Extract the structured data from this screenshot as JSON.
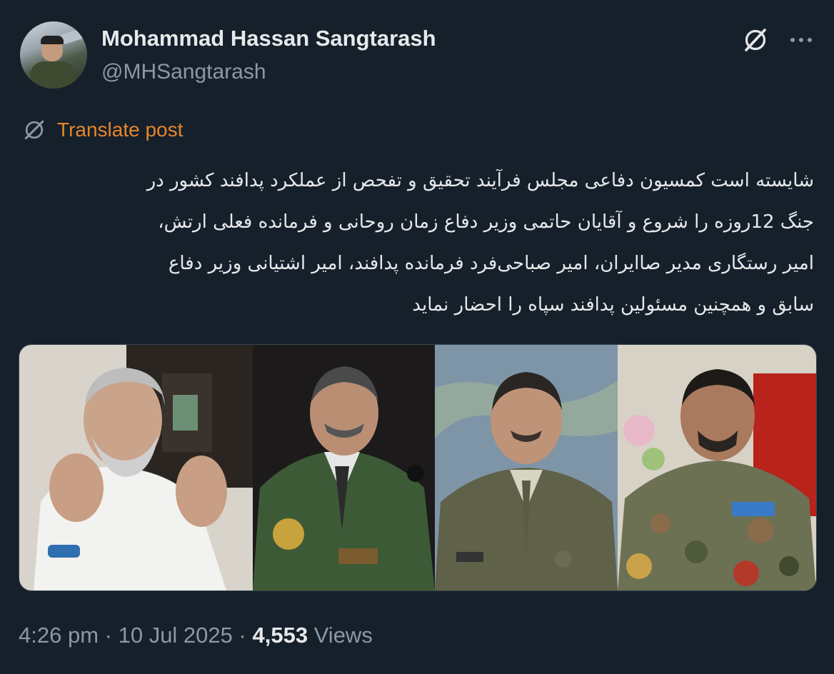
{
  "author": {
    "name": "Mohammad Hassan Sangtarash",
    "handle": "@MHSangtarash"
  },
  "actions": {
    "grok_icon": "grok-icon",
    "more_label": "···"
  },
  "translate": {
    "label": "Translate post"
  },
  "post": {
    "lines": [
      "شایسته است کمسیون دفاعی مجلس فرآیند تحقیق و تفحص از عملکرد پدافند کشور در",
      "جنگ 12روزه را شروع و آقایان حاتمی وزیر دفاع زمان روحانی و فرمانده فعلی ارتش،",
      "امیر رستگاری مدیر صاایران، امیر صباحی‌فرد فرمانده پدافند، امیر اشتیانی وزیر دفاع",
      "سابق و همچنین مسئولین پدافند سپاه را احضار نماید"
    ]
  },
  "meta": {
    "time": "4:26 pm",
    "date": "10 Jul 2025",
    "separator": "·",
    "views_count": "4,553",
    "views_label": "Views"
  },
  "colors": {
    "background": "#15202b",
    "accent_translate": "#e8852a",
    "secondary_text": "#8b98a5"
  }
}
